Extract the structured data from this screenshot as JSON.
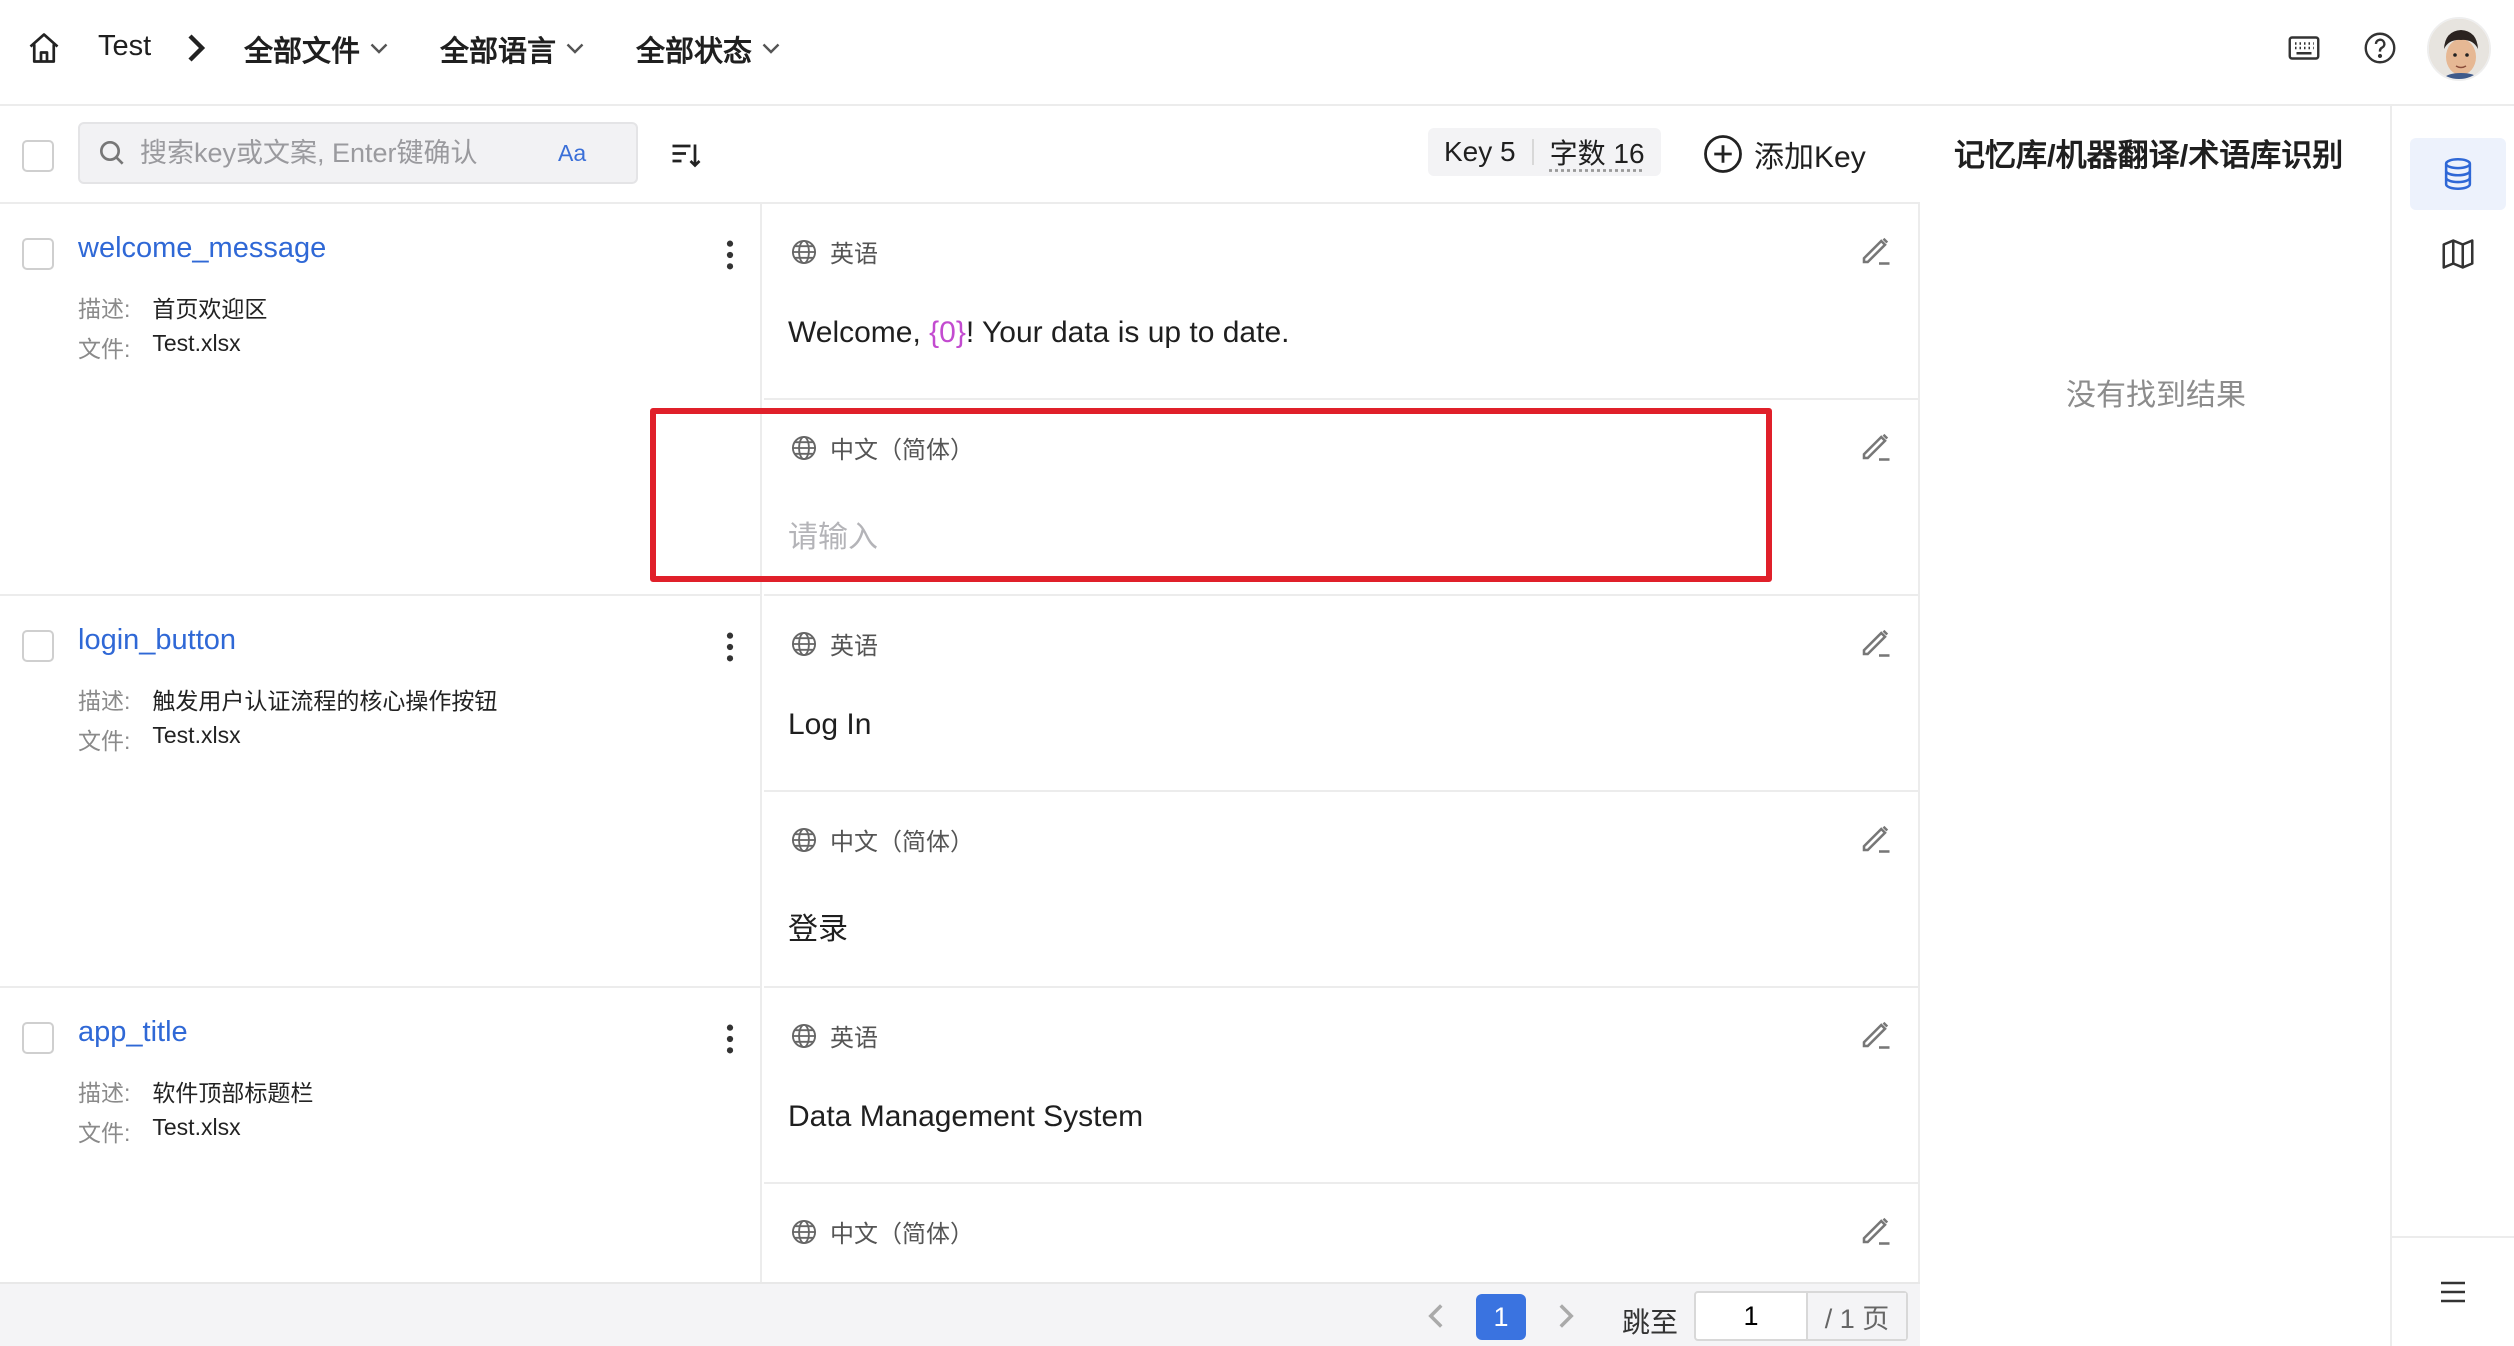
{
  "header": {
    "project": "Test",
    "filters": [
      {
        "label": "全部文件"
      },
      {
        "label": "全部语言"
      },
      {
        "label": "全部状态"
      }
    ]
  },
  "toolbar": {
    "search_placeholder": "搜索key或文案, Enter键确认",
    "case_toggle": "Aa",
    "stats_key": "Key 5",
    "stats_chars": "字数 16",
    "add_key": "添加Key"
  },
  "labels": {
    "desc": "描述:",
    "file": "文件:"
  },
  "entries": [
    {
      "key": "welcome_message",
      "desc": "首页欢迎区",
      "file": "Test.xlsx",
      "translations": [
        {
          "lang": "英语",
          "pre": "Welcome, ",
          "var": "{0}",
          "post": "! Your data is up to date."
        },
        {
          "lang": "中文（简体）",
          "placeholder": "请输入"
        }
      ]
    },
    {
      "key": "login_button",
      "desc": "触发用户认证流程的核心操作按钮",
      "file": "Test.xlsx",
      "translations": [
        {
          "lang": "英语",
          "text": "Log In"
        },
        {
          "lang": "中文（简体）",
          "text": "登录"
        }
      ]
    },
    {
      "key": "app_title",
      "desc": "软件顶部标题栏",
      "file": "Test.xlsx",
      "translations": [
        {
          "lang": "英语",
          "text": "Data Management System"
        },
        {
          "lang": "中文（简体）",
          "text": ""
        }
      ]
    }
  ],
  "side_panel": {
    "title": "记忆库/机器翻译/术语库识别",
    "empty": "没有找到结果"
  },
  "pagination": {
    "current": "1",
    "jump_label": "跳至",
    "jump_value": "1",
    "total": "/ 1 页"
  },
  "colors": {
    "accent": "#2f68d6",
    "highlight": "#e0202a",
    "variable": "#c34bd0"
  }
}
